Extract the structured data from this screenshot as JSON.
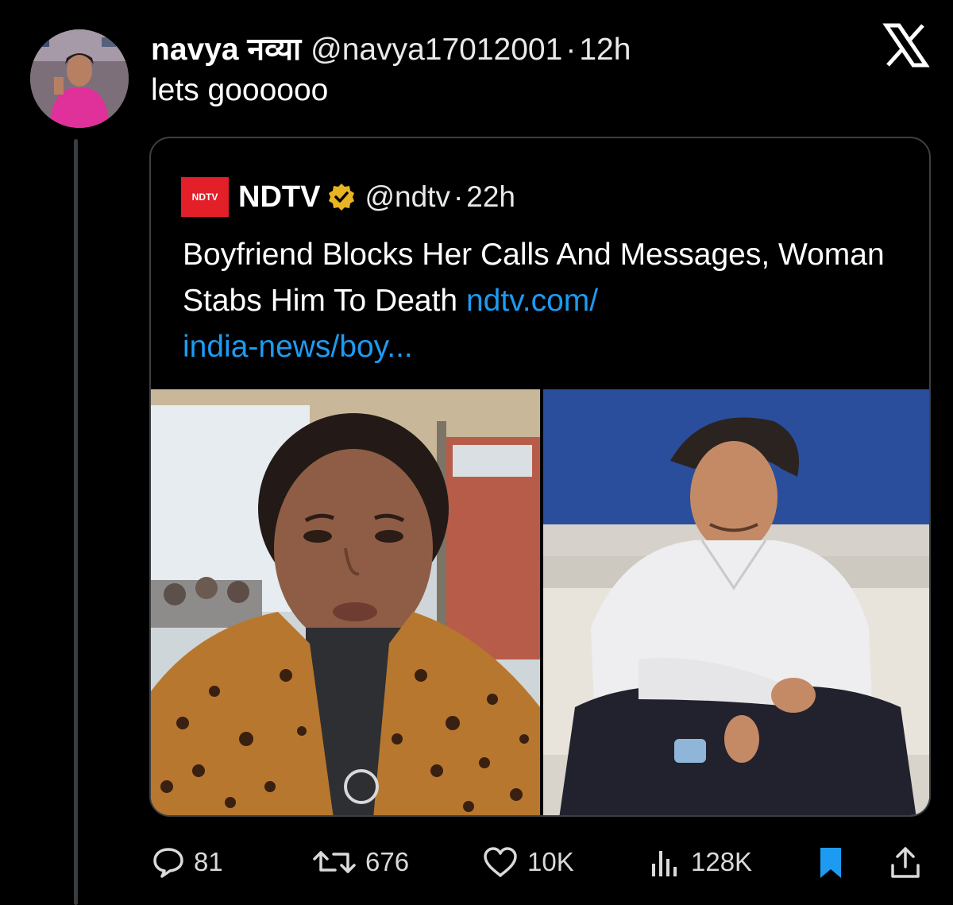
{
  "tweet": {
    "display_name": "navya नव्या",
    "handle": "@navya17012001",
    "separator": "·",
    "time": "12h",
    "text": "lets goooooo",
    "avatar_icon": "profile-photo"
  },
  "brand": {
    "logo_icon": "x-logo-icon"
  },
  "quoted": {
    "logo_text": "NDTV",
    "display_name": "NDTV",
    "verified_icon": "verified-badge-gold-icon",
    "handle": "@ndtv",
    "separator": "·",
    "time": "22h",
    "text": "Boyfriend Blocks Her Calls And Messages, Woman Stabs Him To Death ",
    "link": "ndtv.com/ india-news/boy...",
    "media": [
      {
        "name": "woman-photo"
      },
      {
        "name": "man-photo"
      }
    ]
  },
  "actions": {
    "replies": "81",
    "reposts": "676",
    "likes": "10K",
    "views": "128K"
  },
  "colors": {
    "background": "#000000",
    "link": "#1d9bf0",
    "bookmark_active": "#1d9bf0",
    "verified_gold": "#e8b423",
    "ndtv_red": "#e3202a"
  }
}
